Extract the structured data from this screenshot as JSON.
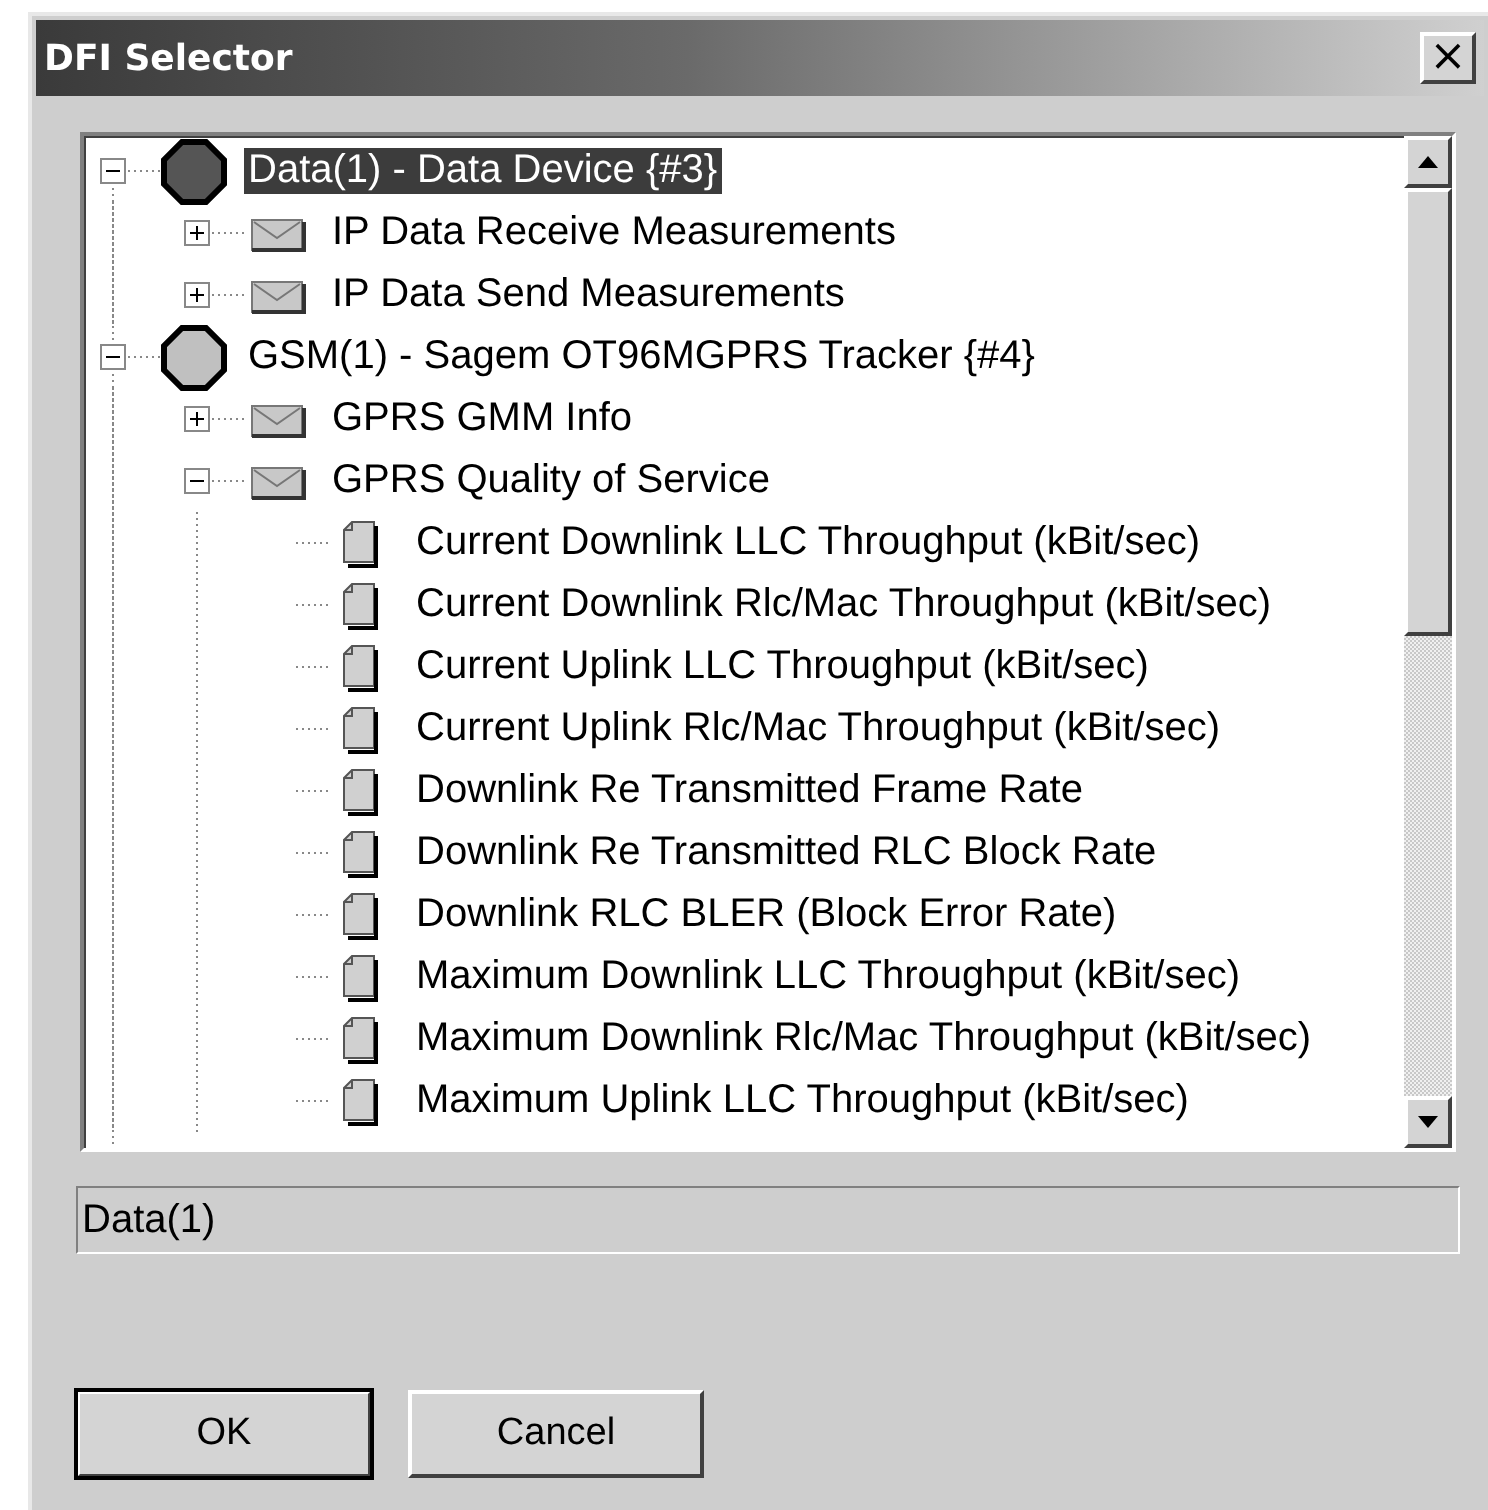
{
  "window": {
    "title": "DFI Selector",
    "close": "×"
  },
  "tree": [
    {
      "kind": "device",
      "label": "Data(1) - Data Device {#3}",
      "color": "#555555",
      "selected": true,
      "expanded": true,
      "children": [
        {
          "kind": "group",
          "label": "IP Data Receive Measurements",
          "selected": false,
          "expanded": false
        },
        {
          "kind": "group",
          "label": "IP Data Send Measurements",
          "selected": false,
          "expanded": false
        }
      ]
    },
    {
      "kind": "device",
      "label": "GSM(1) - Sagem OT96MGPRS Tracker {#4}",
      "color": "#c0c0c0",
      "selected": false,
      "expanded": true,
      "children": [
        {
          "kind": "group",
          "label": "GPRS GMM Info",
          "selected": false,
          "expanded": false
        },
        {
          "kind": "group",
          "label": "GPRS Quality of Service",
          "selected": false,
          "expanded": true,
          "children": [
            {
              "kind": "item",
              "label": "Current Downlink LLC Throughput (kBit/sec)",
              "selected": false
            },
            {
              "kind": "item",
              "label": "Current Downlink Rlc/Mac Throughput (kBit/sec)",
              "selected": false
            },
            {
              "kind": "item",
              "label": "Current Uplink LLC Throughput (kBit/sec)",
              "selected": false
            },
            {
              "kind": "item",
              "label": "Current Uplink Rlc/Mac Throughput (kBit/sec)",
              "selected": false
            },
            {
              "kind": "item",
              "label": "Downlink Re Transmitted Frame Rate",
              "selected": false
            },
            {
              "kind": "item",
              "label": "Downlink Re Transmitted RLC Block Rate",
              "selected": false
            },
            {
              "kind": "item",
              "label": "Downlink RLC BLER (Block Error Rate)",
              "selected": false
            },
            {
              "kind": "item",
              "label": "Maximum Downlink LLC Throughput (kBit/sec)",
              "selected": false
            },
            {
              "kind": "item",
              "label": "Maximum Downlink Rlc/Mac Throughput (kBit/sec)",
              "selected": false
            },
            {
              "kind": "item",
              "label": "Maximum Uplink LLC Throughput (kBit/sec)",
              "selected": false
            }
          ]
        }
      ]
    }
  ],
  "status": {
    "value": "Data(1)"
  },
  "buttons": [
    {
      "label": "OK",
      "default": true
    },
    {
      "label": "Cancel",
      "default": false
    }
  ]
}
